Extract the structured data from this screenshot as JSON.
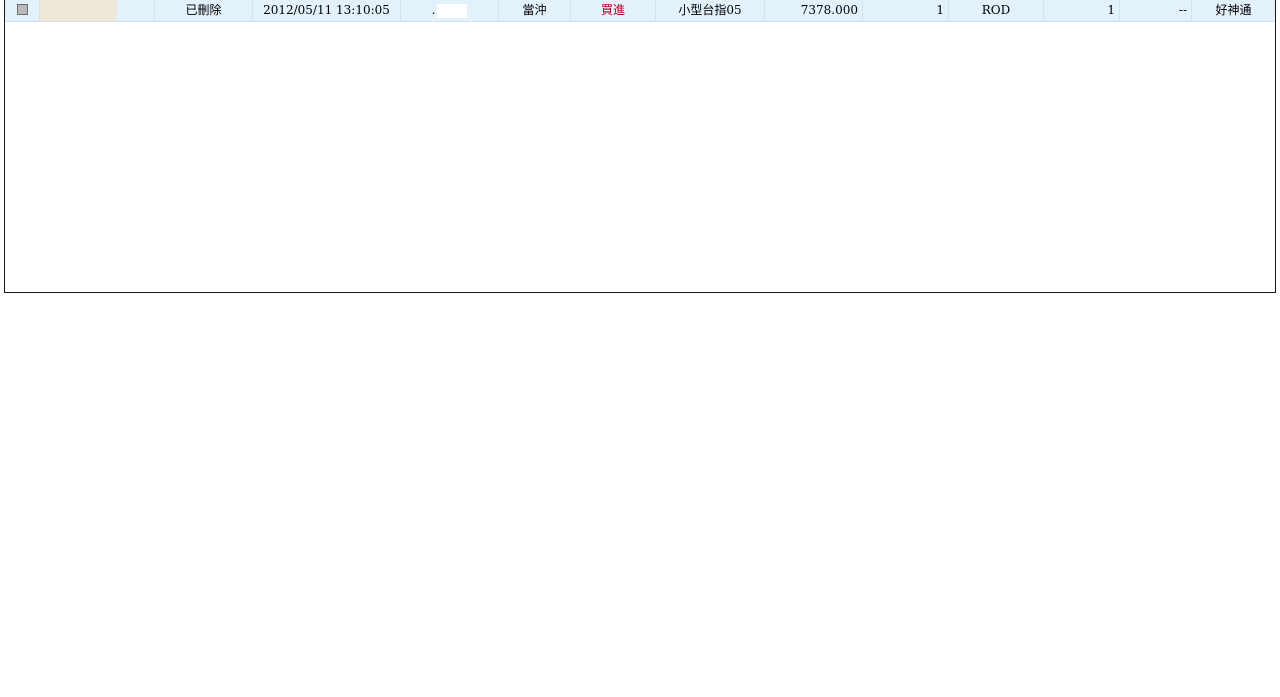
{
  "order_row": {
    "checkbox_checked": false,
    "status": "已刪除",
    "datetime": "2012/05/11 13:10:05",
    "account_masked": ".",
    "order_type": "當沖",
    "side": "買進",
    "product": "小型台指05",
    "price": "7378.000",
    "quantity": "1",
    "time_in_force": "ROD",
    "filled": "1",
    "extra": "--",
    "source": "好神通"
  },
  "colors": {
    "row_background": "#e3f1fb",
    "side_buy": "#b00020",
    "tag_block": "#efe9dc"
  }
}
